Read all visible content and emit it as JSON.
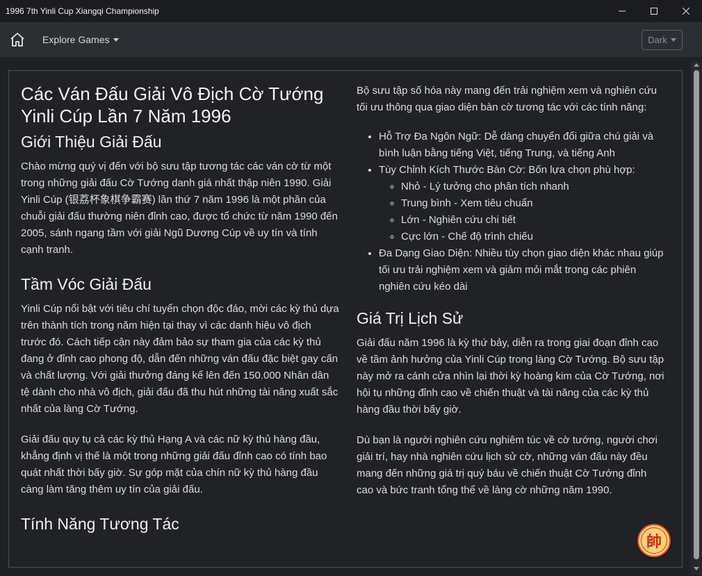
{
  "window": {
    "title": "1996 7th Yinli Cup Xiangqi Championship"
  },
  "navbar": {
    "home_icon": "home-icon",
    "explore_label": "Explore Games",
    "theme_label": "Dark"
  },
  "content": {
    "title": "Các Ván Đấu Giải Vô Địch Cờ Tướng Yinli Cúp Lần 7 Năm 1996",
    "intro": {
      "heading": "Giới Thiệu Giải Đấu",
      "paragraph": "Chào mừng quý vị đến với bộ sưu tập tương tác các ván cờ từ một trong những giải đấu Cờ Tướng danh giá nhất thập niên 1990. Giải Yinli Cúp (银荔杯象棋争霸赛) lần thứ 7 năm 1996 là một phần của chuỗi giải đấu thường niên đỉnh cao, được tổ chức từ năm 1990 đến 2005, sánh ngang tầm với giải Ngũ Dương Cúp về uy tín và tính cạnh tranh."
    },
    "stature": {
      "heading": "Tầm Vóc Giải Đấu",
      "paragraph1": "Yinli Cúp nổi bật với tiêu chí tuyển chọn độc đáo, mời các kỳ thủ dựa trên thành tích trong năm hiện tại thay vì các danh hiệu vô địch trước đó. Cách tiếp cận này đảm bảo sự tham gia của các kỳ thủ đang ở đỉnh cao phong độ, dẫn đến những ván đấu đặc biệt gay cấn và chất lượng. Với giải thưởng đáng kể lên đến 150.000 Nhân dân tệ dành cho nhà vô địch, giải đấu đã thu hút những tài năng xuất sắc nhất của làng Cờ Tướng.",
      "paragraph2": "Giải đấu quy tụ cả các kỳ thủ Hạng A và các nữ kỳ thủ hàng đầu, khẳng định vị thế là một trong những giải đấu đỉnh cao có tính bao quát nhất thời bấy giờ. Sự góp mặt của chín nữ kỳ thủ hàng đầu càng làm tăng thêm uy tín của giải đấu."
    },
    "features": {
      "heading": "Tính Năng Tương Tác",
      "intro": "Bộ sưu tập số hóa này mang đến trải nghiệm xem và nghiên cứu tối ưu thông qua giao diện bàn cờ tương tác với các tính năng:",
      "items": [
        "Hỗ Trợ Đa Ngôn Ngữ: Dễ dàng chuyển đổi giữa chú giải và bình luận bằng tiếng Việt, tiếng Trung, và tiếng Anh",
        "Tùy Chỉnh Kích Thước Bàn Cờ: Bốn lựa chọn phù hợp:",
        "Đa Dạng Giao Diện: Nhiều tùy chọn giao diện khác nhau giúp tối ưu trải nghiệm xem và giảm mỏi mắt trong các phiên nghiên cứu kéo dài"
      ],
      "sizes": [
        "Nhỏ - Lý tưởng cho phân tích nhanh",
        "Trung bình - Xem tiêu chuẩn",
        "Lớn - Nghiên cứu chi tiết",
        "Cực lớn - Chế độ trình chiếu"
      ]
    },
    "history": {
      "heading": "Giá Trị Lịch Sử",
      "paragraph1": "Giải đấu năm 1996 là kỳ thứ bảy, diễn ra trong giai đoạn đỉnh cao về tầm ảnh hưởng của Yinli Cúp trong làng Cờ Tướng. Bộ sưu tập này mở ra cánh cửa nhìn lại thời kỳ hoàng kim của Cờ Tướng, nơi hội tụ những đỉnh cao về chiến thuật và tài năng của các kỳ thủ hàng đầu thời bấy giờ.",
      "paragraph2": "Dù bạn là người nghiên cứu nghiêm túc về cờ tướng, người chơi giải trí, hay nhà nghiên cứu lịch sử cờ, những ván đấu này đều mang đến những giá trị quý báu về chiến thuật Cờ Tướng đỉnh cao và bức tranh tổng thể về làng cờ những năm 1990."
    }
  },
  "piece_badge": {
    "glyph": "帥"
  }
}
